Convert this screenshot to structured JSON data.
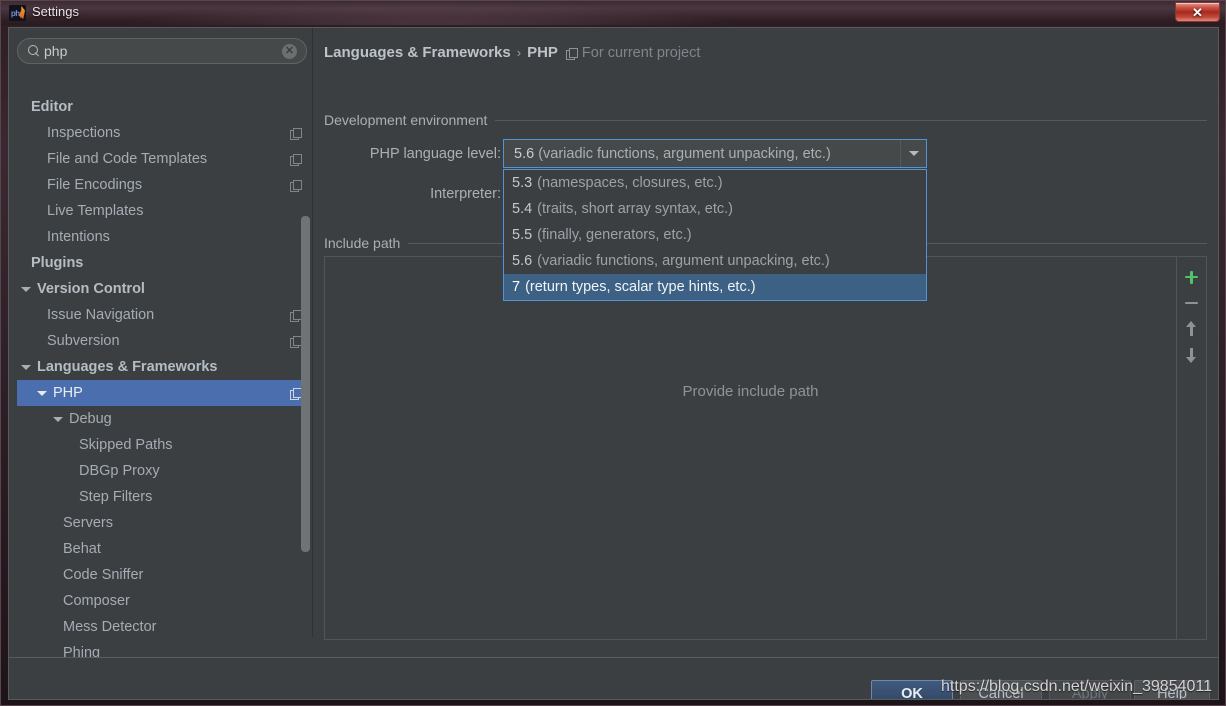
{
  "window": {
    "title": "Settings",
    "app_icon": "php-storm-icon",
    "close_label": "✕"
  },
  "search": {
    "value": "php",
    "placeholder": "Search settings",
    "icon": "search-icon",
    "clear_icon": "clear-circle-icon",
    "clear_label": "✕"
  },
  "tree": {
    "items": [
      {
        "label": "Editor",
        "indent": 0,
        "bold": true,
        "arrow": false,
        "proj_icon": false,
        "selected": false
      },
      {
        "label": "Inspections",
        "indent": 1,
        "bold": false,
        "arrow": false,
        "proj_icon": true,
        "selected": false
      },
      {
        "label": "File and Code Templates",
        "indent": 1,
        "bold": false,
        "arrow": false,
        "proj_icon": true,
        "selected": false
      },
      {
        "label": "File Encodings",
        "indent": 1,
        "bold": false,
        "arrow": false,
        "proj_icon": true,
        "selected": false
      },
      {
        "label": "Live Templates",
        "indent": 1,
        "bold": false,
        "arrow": false,
        "proj_icon": false,
        "selected": false
      },
      {
        "label": "Intentions",
        "indent": 1,
        "bold": false,
        "arrow": false,
        "proj_icon": false,
        "selected": false
      },
      {
        "label": "Plugins",
        "indent": 0,
        "bold": true,
        "arrow": false,
        "proj_icon": false,
        "selected": false
      },
      {
        "label": "Version Control",
        "indent": 0,
        "bold": true,
        "arrow": true,
        "proj_icon": false,
        "selected": false
      },
      {
        "label": "Issue Navigation",
        "indent": 1,
        "bold": false,
        "arrow": false,
        "proj_icon": true,
        "selected": false
      },
      {
        "label": "Subversion",
        "indent": 1,
        "bold": false,
        "arrow": false,
        "proj_icon": true,
        "selected": false
      },
      {
        "label": "Languages & Frameworks",
        "indent": 0,
        "bold": true,
        "arrow": true,
        "proj_icon": false,
        "selected": false
      },
      {
        "label": "PHP",
        "indent": 1,
        "bold": false,
        "arrow": true,
        "proj_icon": true,
        "selected": true
      },
      {
        "label": "Debug",
        "indent": 2,
        "bold": false,
        "arrow": true,
        "proj_icon": false,
        "selected": false
      },
      {
        "label": "Skipped Paths",
        "indent": 3,
        "bold": false,
        "arrow": false,
        "proj_icon": false,
        "selected": false
      },
      {
        "label": "DBGp Proxy",
        "indent": 3,
        "bold": false,
        "arrow": false,
        "proj_icon": false,
        "selected": false
      },
      {
        "label": "Step Filters",
        "indent": 3,
        "bold": false,
        "arrow": false,
        "proj_icon": false,
        "selected": false
      },
      {
        "label": "Servers",
        "indent": 2,
        "bold": false,
        "arrow": false,
        "proj_icon": false,
        "selected": false
      },
      {
        "label": "Behat",
        "indent": 2,
        "bold": false,
        "arrow": false,
        "proj_icon": false,
        "selected": false
      },
      {
        "label": "Code Sniffer",
        "indent": 2,
        "bold": false,
        "arrow": false,
        "proj_icon": false,
        "selected": false
      },
      {
        "label": "Composer",
        "indent": 2,
        "bold": false,
        "arrow": false,
        "proj_icon": false,
        "selected": false
      },
      {
        "label": "Mess Detector",
        "indent": 2,
        "bold": false,
        "arrow": false,
        "proj_icon": false,
        "selected": false
      },
      {
        "label": "Phing",
        "indent": 2,
        "bold": false,
        "arrow": false,
        "proj_icon": false,
        "selected": false
      }
    ]
  },
  "breadcrumb": {
    "parent": "Languages & Frameworks",
    "separator": "›",
    "current": "PHP",
    "scope_icon": "project-scope-icon",
    "scope_label": "For current project"
  },
  "dev_env": {
    "group_title": "Development environment",
    "lang_level_label": "PHP language level:",
    "interpreter_label": "Interpreter:",
    "selected_level_number": "5.6",
    "selected_level_desc": "(variadic functions, argument unpacking, etc.)",
    "dropdown_arrow_icon": "chevron-down-icon",
    "options": [
      {
        "number": "5.3",
        "desc": "(namespaces, closures, etc.)",
        "selected": false
      },
      {
        "number": "5.4",
        "desc": "(traits, short array syntax, etc.)",
        "selected": false
      },
      {
        "number": "5.5",
        "desc": "(finally, generators, etc.)",
        "selected": false
      },
      {
        "number": "5.6",
        "desc": "(variadic functions, argument unpacking, etc.)",
        "selected": false
      },
      {
        "number": "7",
        "desc": "(return types, scalar type hints, etc.)",
        "selected": true
      }
    ]
  },
  "include_path": {
    "group_title": "Include path",
    "empty_text": "Provide include path",
    "toolbar": {
      "add_icon": "plus-icon",
      "remove_icon": "minus-icon",
      "up_icon": "arrow-up-icon",
      "down_icon": "arrow-down-icon"
    }
  },
  "footer": {
    "ok": "OK",
    "cancel": "Cancel",
    "apply": "Apply",
    "help": "Help"
  },
  "watermark": "https://blog.csdn.net/weixin_39854011",
  "colors": {
    "panel_bg": "#3c3f41",
    "selection_blue": "#4b6eaf",
    "dropdown_selection": "#3d6185",
    "focus_border": "#5394d4",
    "add_green": "#4fc26b",
    "text_primary": "#a9b0b6",
    "titlebar": "#3a2930"
  }
}
